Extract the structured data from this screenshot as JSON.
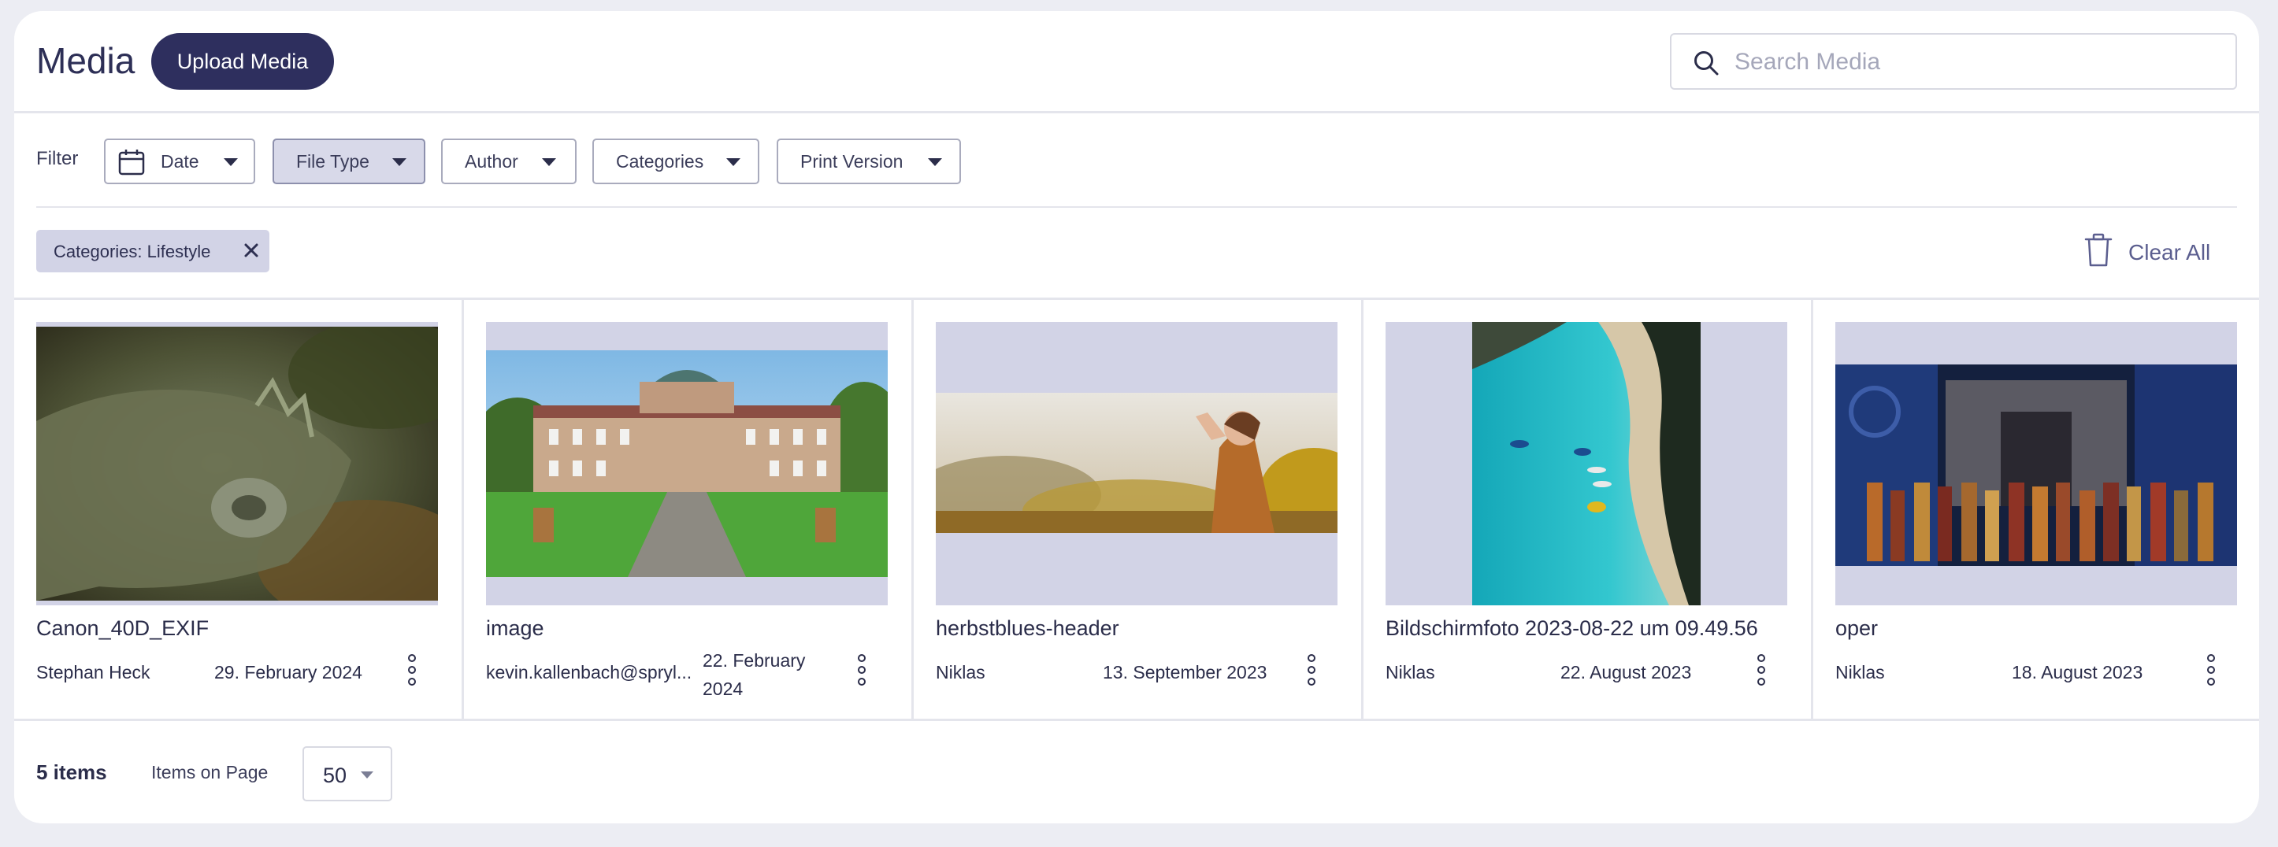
{
  "header": {
    "title": "Media",
    "upload_label": "Upload Media",
    "search_placeholder": "Search Media"
  },
  "filters": {
    "label": "Filter",
    "buttons": [
      {
        "label": "Date",
        "icon": "calendar-icon"
      },
      {
        "label": "File Type",
        "active": true
      },
      {
        "label": "Author"
      },
      {
        "label": "Categories"
      },
      {
        "label": "Print Version"
      }
    ]
  },
  "active_filters": {
    "chips": [
      {
        "label": "Categories: Lifestyle"
      }
    ],
    "clear_all_label": "Clear All"
  },
  "media": {
    "items": [
      {
        "title": "Canon_40D_EXIF",
        "author": "Stephan Heck",
        "date": "29. February 2024",
        "image": "iguana-photo"
      },
      {
        "title": "image",
        "author": "kevin.kallenbach@spryl...",
        "date": "22. February 2024",
        "image": "palace-photo"
      },
      {
        "title": "herbstblues-header",
        "author": "Niklas",
        "date": "13. September 2023",
        "image": "woman-autumn-photo"
      },
      {
        "title": "Bildschirmfoto 2023-08-22 um 09.49.56",
        "author": "Niklas",
        "date": "22. August 2023",
        "image": "beach-aerial-photo"
      },
      {
        "title": "oper",
        "author": "Niklas",
        "date": "18. August 2023",
        "image": "opera-stage-photo"
      }
    ]
  },
  "footer": {
    "count_label": "5 items",
    "per_page_label": "Items on Page",
    "per_page_value": "50"
  },
  "colors": {
    "accent": "#2e2f5e",
    "chip_bg": "#d2d3e6",
    "page_bg": "#ecedf3"
  }
}
